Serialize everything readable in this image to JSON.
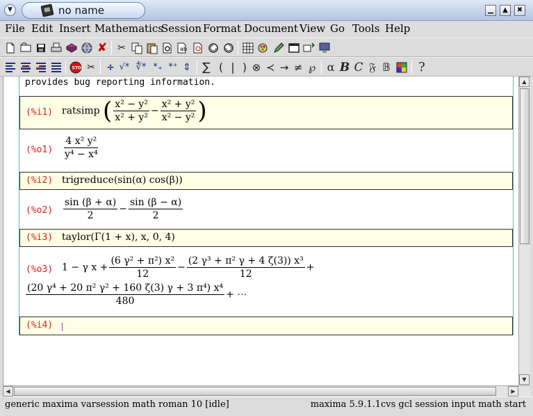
{
  "window": {
    "title": "no name",
    "app_icon": "texmacs-app-icon",
    "menu_button_icon": "chevron-down-icon",
    "controls": [
      "minimize-icon",
      "maximize-icon",
      "close-icon"
    ]
  },
  "menubar": {
    "items": [
      "File",
      "Edit",
      "Insert",
      "Mathematics",
      "Session",
      "Format",
      "Document",
      "View",
      "Go",
      "Tools",
      "Help"
    ]
  },
  "toolbar1": {
    "icons": [
      "new-document-icon",
      "open-icon",
      "save-icon",
      "print-icon",
      "book-icon",
      "globe-icon",
      "close-document-icon",
      "cut-icon",
      "copy-icon",
      "paste-icon",
      "search-icon",
      "replace-icon",
      "spell-icon",
      "undo-icon",
      "redo-icon",
      "table-icon",
      "paint-icon",
      "pencil-icon",
      "window-icon",
      "session-icon",
      "monitor-icon"
    ]
  },
  "toolbar2": {
    "icons": [
      "align-left-icon",
      "align-center-icon",
      "align-right-icon",
      "align-justify-icon",
      "stop-icon",
      "scissors-icon",
      "divide-icon",
      "sqrt-icon",
      "nth-root-icon",
      "subscript-icon",
      "superscript-icon",
      "above-below-icon",
      "big-operator-icon",
      "paren-icon",
      "bar-icon",
      "paren-close-icon",
      "otimes-icon",
      "prec-icon",
      "arrow-icon",
      "neq-icon",
      "wp-icon",
      "alpha-icon",
      "bold-icon",
      "calligraphic-icon",
      "fraktur-icon",
      "blackboard-icon",
      "color-palette-icon",
      "help-icon"
    ],
    "glyphs": {
      "divide": "÷",
      "sqrt": "√*",
      "root": "∜*",
      "sub": "*₊",
      "sup": "*⁺",
      "updown": "⇕",
      "sum": "∑",
      "lparen": "(",
      "bar": "|",
      "rparen": ")",
      "otimes": "⊗",
      "prec": "≺",
      "arrow": "→",
      "neq": "≠",
      "wp": "℘",
      "alpha": "α",
      "bold": "B",
      "cal": "C",
      "frak": "𝔉",
      "bb": "𝔹",
      "help": "?"
    }
  },
  "document": {
    "intro_text": "provides bug reporting information.",
    "cells": {
      "i1": {
        "label": "(%i1)",
        "fn": "ratsimp",
        "a_num": "x² − y²",
        "a_den": "x² + y²",
        "minus": "−",
        "b_num": "x² + y²",
        "b_den": "x² − y²"
      },
      "o1": {
        "label": "(%o1)",
        "num": "4 x² y²",
        "den": "y⁴ − x⁴"
      },
      "i2": {
        "label": "(%i2)",
        "text": "trigreduce(sin(α) cos(β))"
      },
      "o2": {
        "label": "(%o2)",
        "a_num": "sin (β + α)",
        "a_den": "2",
        "minus": "−",
        "b_num": "sin (β − α)",
        "b_den": "2"
      },
      "i3": {
        "label": "(%i3)",
        "text": "taylor(Γ(1 + x), x, 0, 4)"
      },
      "o3": {
        "label": "(%o3)",
        "lead": "1 − γ x +",
        "t2_num": "(6 γ² + π²) x²",
        "t2_den": "12",
        "minus": "−",
        "t3_num": "(2 γ³ + π² γ + 4 ζ(3)) x³",
        "t3_den": "12",
        "plus": "+",
        "t4_num": "(20 γ⁴ + 20 π² γ² + 160 ζ(3) γ + 3 π⁴) x⁴",
        "t4_den": "480",
        "tail": "+ ⋯"
      },
      "i4": {
        "label": "(%i4)",
        "value": ""
      }
    }
  },
  "statusbar": {
    "left": "generic maxima varsession math roman 10 [idle]",
    "right": "maxima 5.9.1.1cvs gcl session input math start"
  },
  "colors": {
    "input_bg": "#ffffe6",
    "prompt_label": "#e0201c",
    "session_border": "#3fc3c3",
    "titlebar": "#c7d6ee"
  }
}
